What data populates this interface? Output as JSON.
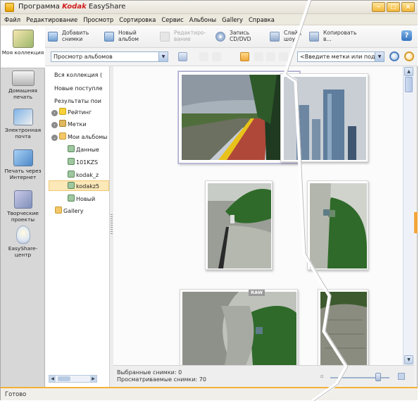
{
  "window": {
    "title_prefix": "Программа ",
    "brand": "Kodak",
    "title_suffix": " EasyShare",
    "buttons": [
      "minimize",
      "maximize",
      "close"
    ]
  },
  "menu": [
    "Файл",
    "Редактирование",
    "Просмотр",
    "Сортировка",
    "Сервис",
    "Альбоны",
    "Gallery",
    "Справка"
  ],
  "nav": [
    {
      "label": "Моя коллекция",
      "icon": "my-collection-icon",
      "active": true
    },
    {
      "label": "Домашняя печать",
      "icon": "home-print-icon",
      "active": false
    },
    {
      "label": "Электронная почта",
      "icon": "email-icon",
      "active": false
    },
    {
      "label": "Печать через Интернет",
      "icon": "online-print-icon",
      "active": false
    },
    {
      "label": "Творческие проекты",
      "icon": "creative-projects-icon",
      "active": false
    },
    {
      "label": "EasyShare-центр",
      "icon": "easyshare-center-icon",
      "active": false
    }
  ],
  "toolbar": {
    "add": "Добавить снимки",
    "new_album": "Новый альбом",
    "edit": "Редактиро- вание",
    "burn": "Запись CD/DVD",
    "slideshow": "Слайд шоу",
    "copy": "Копировать в...",
    "help": "?"
  },
  "view_select": "Просмотр альбомов",
  "tag_search": "<Введите метки или под",
  "tree": [
    {
      "label": "Вся коллекция (",
      "level": 0
    },
    {
      "label": "Новые поступле",
      "level": 0
    },
    {
      "label": "Результаты пои",
      "level": 0
    },
    {
      "label": "Рейтинг",
      "level": 0,
      "expander": true
    },
    {
      "label": "Метки",
      "level": 0,
      "expander": true
    },
    {
      "label": "Мои альбомы",
      "level": 0,
      "expander": true
    },
    {
      "label": "Данные",
      "level": 1
    },
    {
      "label": "101KZS",
      "level": 1
    },
    {
      "label": "kodak_z",
      "level": 1
    },
    {
      "label": "kodakz5",
      "level": 1,
      "selected": true
    },
    {
      "label": "Новый",
      "level": 1
    },
    {
      "label": "Gallery",
      "level": 0
    }
  ],
  "thumbnails": [
    {
      "name": "promenade-photo",
      "selected": true,
      "raw": false
    },
    {
      "name": "skyscrapers-photo",
      "selected": false,
      "raw": false
    },
    {
      "name": "embankment-photo",
      "selected": false,
      "raw": false
    },
    {
      "name": "embankment-rotated-photo",
      "selected": false,
      "raw": false
    },
    {
      "name": "embankment-raw-photo",
      "selected": false,
      "raw": true,
      "raw_label": "RAW"
    },
    {
      "name": "stone-wall-photo",
      "selected": false,
      "raw": false
    }
  ],
  "status": {
    "selected_photos": "Выбранные снимки: 0",
    "viewed_photos": "Просматриваемые снимки: 70",
    "ready": "Готово"
  },
  "colors": {
    "accent": "#f3b13a",
    "selection": "#fde8b8",
    "brand_red": "#d01e1e"
  }
}
